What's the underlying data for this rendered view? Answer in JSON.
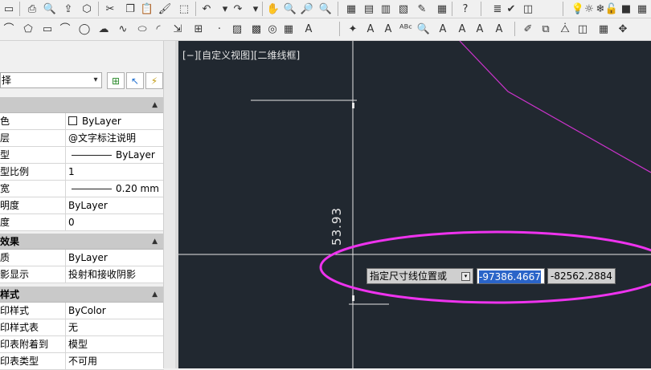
{
  "toolbar_top": {
    "icons": [
      "form-icon",
      "print-icon",
      "preview-icon",
      "publish-icon",
      "3d-print-icon",
      "cut-icon",
      "copy-icon",
      "paste-icon",
      "match-prop-icon",
      "block-editor-icon",
      "undo-icon",
      "undo-dropdown-icon",
      "redo-icon",
      "redo-dropdown-icon",
      "pan-icon",
      "zoom-realtime-icon",
      "zoom-window-icon",
      "zoom-previous-icon",
      "properties-icon",
      "design-center-icon",
      "tool-palette-icon",
      "sheet-set-icon",
      "markup-icon",
      "quickcalc-icon",
      "help-icon",
      "layer-icon",
      "make-current-icon",
      "layer-states-icon",
      "lightbulb-icon",
      "sun-icon",
      "freeze-icon",
      "lock-icon",
      "color-icon",
      "layer-combo-icon"
    ],
    "glyphs": [
      "▭",
      "⎙",
      "🔍",
      "⇪",
      "⬡",
      "✂",
      "❐",
      "📋",
      "🖌",
      "⬚",
      "↶",
      "▾",
      "↷",
      "▾",
      "✋",
      "🔍",
      "🔎",
      "🔍",
      "▦",
      "▤",
      "▥",
      "▧",
      "✎",
      "▦",
      "?",
      "≣",
      "✔",
      "◫",
      "💡",
      "☼",
      "❄",
      "🔓",
      "■",
      "▦"
    ]
  },
  "toolbar_draw": {
    "icons": [
      "arc-icon",
      "polygon-icon",
      "rectangle-icon",
      "arc2-icon",
      "circle-icon",
      "revcloud-icon",
      "spline-icon",
      "ellipse-icon",
      "ellipse-arc-icon",
      "insert-block-icon",
      "make-block-icon",
      "point-icon",
      "hatch-icon",
      "gradient-icon",
      "region-icon",
      "table-icon",
      "mtext-icon",
      "add-selected-icon",
      "text-icon",
      "text-style-icon",
      "spell-check-icon",
      "find-text-icon",
      "edit-text-icon",
      "text-align-icon",
      "text-scale-icon",
      "mirror-text-icon",
      "erase-icon",
      "copy-obj-icon",
      "mirror-icon",
      "offset-icon",
      "array-icon",
      "move-icon"
    ],
    "glyphs": [
      "⌒",
      "⬠",
      "▭",
      "⌒",
      "◯",
      "☁",
      "∿",
      "⬭",
      "◜",
      "⇲",
      "⊞",
      "·",
      "▨",
      "▩",
      "◎",
      "▦",
      "A",
      "✦",
      "A",
      "A",
      "ᴬᴮᶜ",
      "🔍",
      "A",
      "A",
      "A",
      "A",
      "✐",
      "⧉",
      "⧊",
      "◫",
      "▦",
      "✥"
    ]
  },
  "properties": {
    "selection_combo": "择",
    "sections": [
      {
        "title": "",
        "rows": [
          {
            "name": "色",
            "value": "ByLayer",
            "swatch": true
          },
          {
            "name": "层",
            "value": "@文字标注说明"
          },
          {
            "name": "型",
            "value": "ByLayer",
            "line": true
          },
          {
            "name": "型比例",
            "value": "1"
          },
          {
            "name": "宽",
            "value": "0.20 mm",
            "line": true
          },
          {
            "name": "明度",
            "value": "ByLayer"
          },
          {
            "name": "度",
            "value": "0"
          }
        ]
      },
      {
        "title": "效果",
        "rows": [
          {
            "name": "质",
            "value": "ByLayer"
          },
          {
            "name": "影显示",
            "value": "投射和接收阴影"
          }
        ]
      },
      {
        "title": "样式",
        "rows": [
          {
            "name": "印样式",
            "value": "ByColor"
          },
          {
            "name": "印样式表",
            "value": "无"
          },
          {
            "name": "印表附着到",
            "value": "模型"
          },
          {
            "name": "印表类型",
            "value": "不可用"
          }
        ]
      }
    ]
  },
  "viewport": {
    "label": "[−][自定义视图][二维线框]",
    "dimension_text": "53.93",
    "background": "#212830",
    "geometry_color": "#cc33cc",
    "highlight_color": "#ee33ee"
  },
  "dynamic_input": {
    "prompt": "指定尺寸线位置或",
    "x_value": "-97386.4667",
    "y_value": "-82562.2884"
  }
}
